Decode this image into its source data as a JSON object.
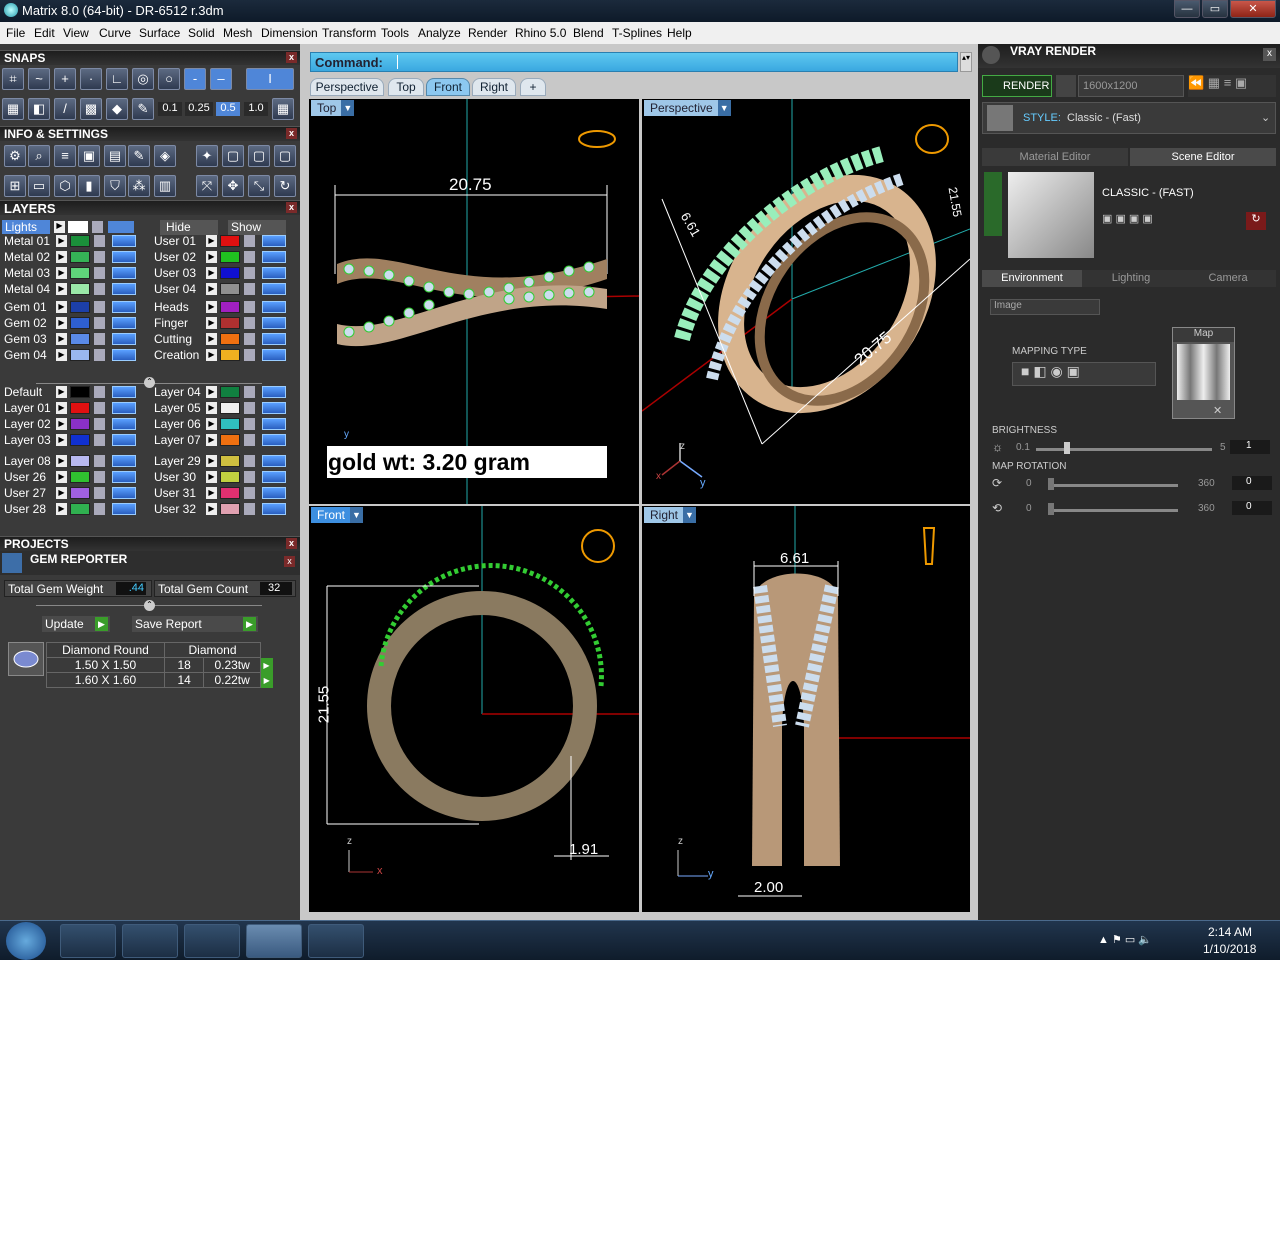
{
  "window": {
    "title": "Matrix 8.0 (64-bit) - DR-6512 r.3dm",
    "min": "—",
    "max": "▭",
    "close": "✕"
  },
  "menu": [
    "File",
    "Edit",
    "View",
    "Curve",
    "Surface",
    "Solid",
    "Mesh",
    "Dimension",
    "Transform",
    "Tools",
    "Analyze",
    "Render",
    "Rhino 5.0",
    "Blend",
    "T-Splines",
    "Help"
  ],
  "snaps": {
    "title": "SNAPS",
    "values": [
      "0.1",
      "0.25",
      "0.5",
      "1.0"
    ]
  },
  "info": {
    "title": "INFO & SETTINGS"
  },
  "layers": {
    "title": "LAYERS",
    "lights": "Lights",
    "hide": "Hide",
    "show": "Show",
    "left": [
      "Metal 01",
      "Metal 02",
      "Metal 03",
      "Metal 04",
      "Gem 01",
      "Gem 02",
      "Gem 03",
      "Gem 04",
      "Default",
      "Layer 01",
      "Layer 02",
      "Layer 03",
      "Layer 08",
      "User 26",
      "User 27",
      "User 28"
    ],
    "left_colors": [
      "#1a8f3a",
      "#35b356",
      "#5fd47a",
      "#9ae8a8",
      "#1c3fa8",
      "#2e5fd0",
      "#5a8ae8",
      "#9ab8f0",
      "#000000",
      "#e01010",
      "#8a30c8",
      "#1030d0",
      "#b8b8f0",
      "#30c030",
      "#a060e0",
      "#30b050"
    ],
    "right": [
      "User 01",
      "User 02",
      "User 03",
      "User 04",
      "Heads",
      "Finger",
      "Cutting",
      "Creation",
      "Layer 04",
      "Layer 05",
      "Layer 06",
      "Layer 07",
      "Layer 29",
      "User 30",
      "User 31",
      "User 32"
    ],
    "right_colors": [
      "#e01010",
      "#20c020",
      "#1010d0",
      "#909090",
      "#a020c0",
      "#b03030",
      "#f07010",
      "#f0b020",
      "#108040",
      "#f0f0f0",
      "#30c0c0",
      "#f07010",
      "#d0c040",
      "#c0d040",
      "#e03070",
      "#e0a0b0"
    ]
  },
  "projects": {
    "title": "PROJECTS"
  },
  "gem_reporter": {
    "title": "GEM REPORTER",
    "weight_label": "Total Gem Weight",
    "weight": ".44",
    "count_label": "Total Gem Count",
    "count": "32",
    "update": "Update",
    "save": "Save Report",
    "headers": [
      "Diamond Round",
      "Diamond"
    ],
    "rows": [
      {
        "size": "1.50 X 1.50",
        "count": "18",
        "tw": "0.23tw"
      },
      {
        "size": "1.60 X 1.60",
        "count": "14",
        "tw": "0.22tw"
      }
    ]
  },
  "command": {
    "label": "Command:"
  },
  "view_tabs": [
    "Perspective",
    "Top",
    "Front",
    "Right",
    "+"
  ],
  "viewports": {
    "top": "Top",
    "perspective": "Perspective",
    "front": "Front",
    "right": "Right"
  },
  "dims": {
    "top_width": "20.75",
    "persp_a": "6.61",
    "persp_b": "20.75",
    "persp_c": "21.55",
    "front_h": "21.55",
    "front_w": "1.91",
    "right_w": "6.61",
    "right_b": "2.00"
  },
  "annotation": "gold wt: 3.20 gram",
  "axes": {
    "x": "x",
    "y": "y",
    "z": "z"
  },
  "vray": {
    "title": "VRAY RENDER",
    "render": "RENDER",
    "resolution": "1600x1200",
    "style_label": "STYLE:",
    "style": "Classic - (Fast)",
    "tabs": [
      "Material Editor",
      "Scene Editor"
    ],
    "preset": "CLASSIC - (FAST)",
    "env_tabs": [
      "Environment",
      "Lighting",
      "Camera"
    ],
    "env_type": "Image",
    "map": "Map",
    "mapping_type": "MAPPING TYPE",
    "brightness": {
      "label": "BRIGHTNESS",
      "min": "0.1",
      "max": "5",
      "value": "1"
    },
    "rotation": {
      "label": "MAP ROTATION",
      "min": "0",
      "max": "360",
      "value1": "0",
      "value2": "0"
    }
  },
  "taskbar": {
    "time": "2:14 AM",
    "date": "1/10/2018"
  }
}
